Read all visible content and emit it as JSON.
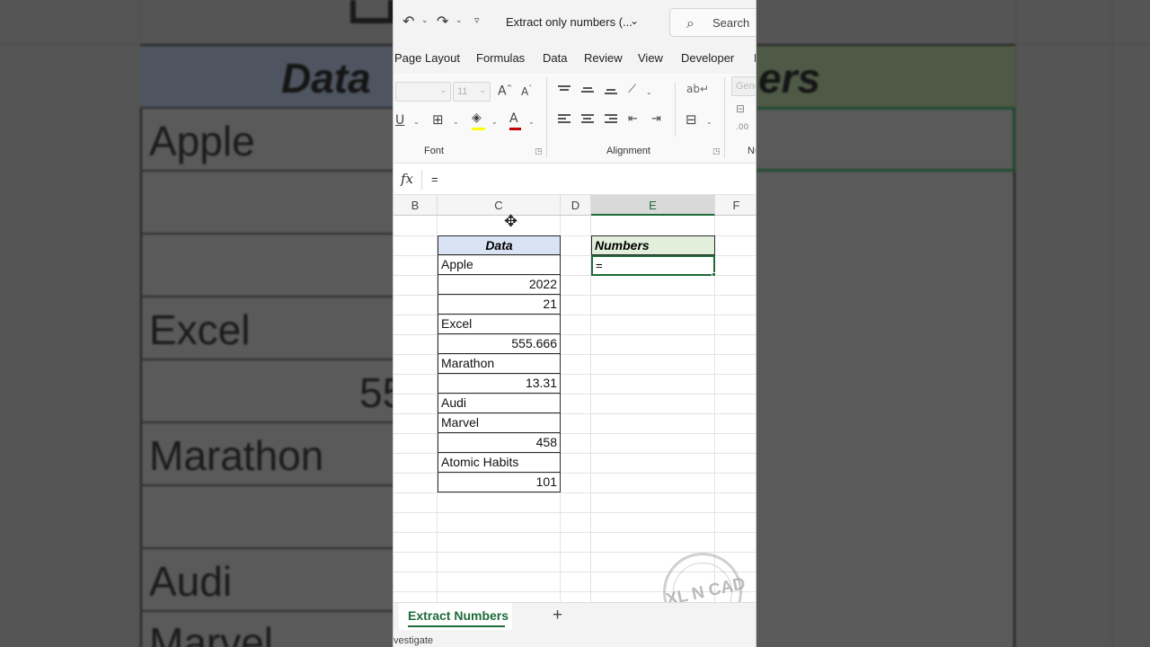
{
  "titlebar": {
    "undo_icon": "undo-icon",
    "redo_icon": "redo-icon",
    "customize_icon": "customize-qat-icon",
    "doc_title": "Extract only numbers (...",
    "search_placeholder": "Search"
  },
  "menu": {
    "items": [
      "Page Layout",
      "Formulas",
      "Data",
      "Review",
      "View",
      "Developer",
      "H"
    ]
  },
  "ribbon": {
    "font_name": "",
    "font_size": "11",
    "font_group_label": "Font",
    "alignment_group_label": "Alignment",
    "number_group_label": "Nu",
    "number_format": "Gene",
    "underline": "U",
    "grow_font": "A",
    "shrink_font": "A",
    "font_color_letter": "A",
    "fill_color": "#ffff00",
    "font_color": "#c00000"
  },
  "formula_bar": {
    "fx": "fx",
    "value": "="
  },
  "columns": [
    "B",
    "C",
    "D",
    "E",
    "F"
  ],
  "active_column": "E",
  "table": {
    "header": "Data",
    "rows": [
      "Apple",
      "2022",
      "21",
      "Excel",
      "555.666",
      "Marathon",
      "13.31",
      "Audi",
      "Marvel",
      "458",
      "Atomic Habits",
      "101"
    ]
  },
  "numbers": {
    "header": "Numbers",
    "active_cell_value": "="
  },
  "watermark": "XL N CAD",
  "sheet": {
    "tab_name": "Extract Numbers",
    "add_label": "+"
  },
  "status": {
    "text": "vestigate"
  },
  "backdrop": {
    "data_header": "Data",
    "numbers_header_fragment": "ers",
    "rows": [
      "Apple",
      "",
      "",
      "Excel",
      "55",
      "Marathon",
      "",
      "Audi",
      "Marvel"
    ]
  },
  "colors": {
    "excel_green": "#1e6b3a",
    "data_header_fill": "#dae3f3",
    "numbers_header_fill": "#e2efda"
  }
}
